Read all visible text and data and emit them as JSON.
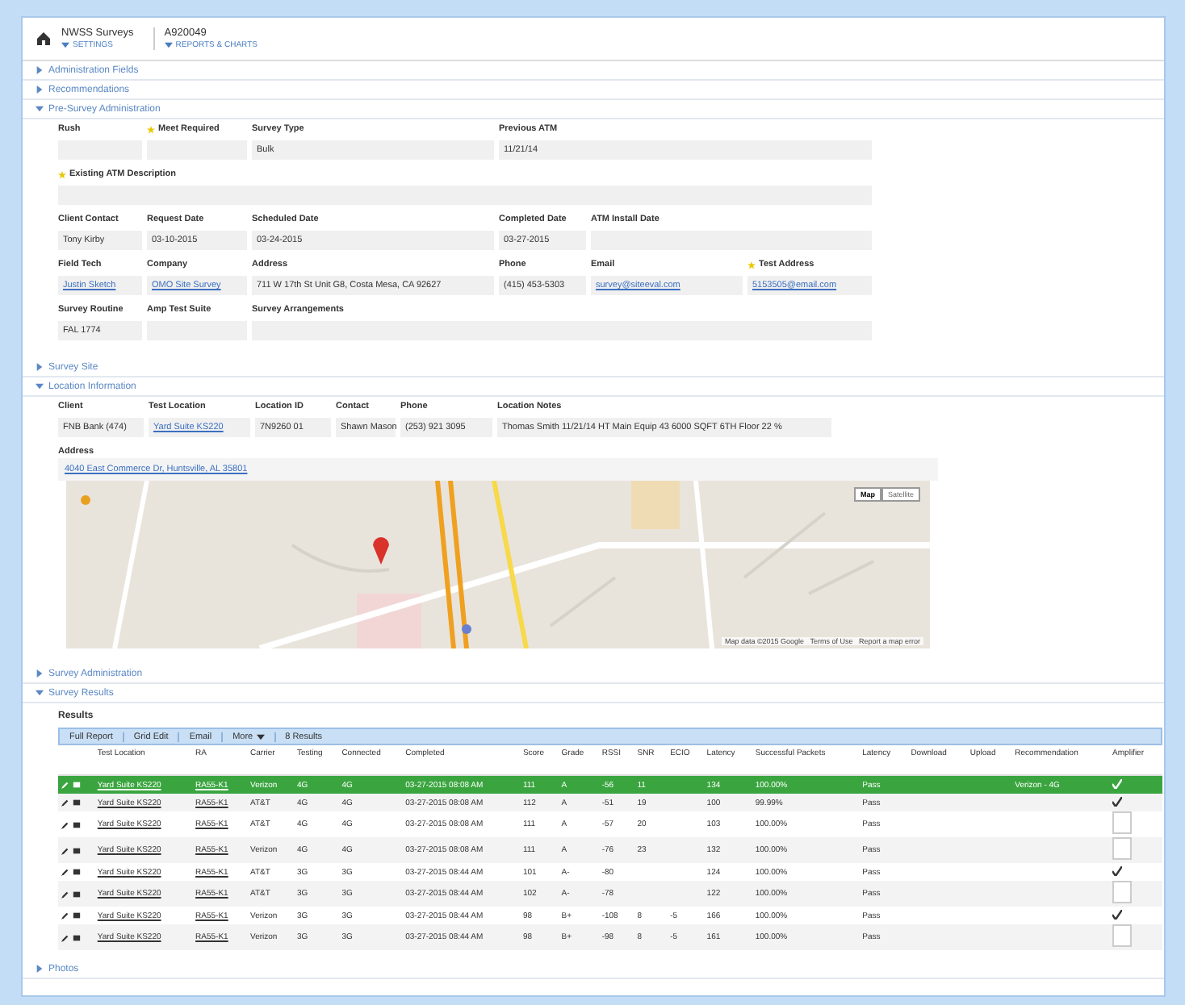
{
  "header": {
    "app": {
      "title": "NWSS Surveys",
      "menu": "SETTINGS"
    },
    "record": {
      "title": "A920049",
      "menu": "REPORTS & CHARTS"
    }
  },
  "sections": [
    {
      "title": "Administration Fields",
      "expanded": false
    },
    {
      "title": "Recommendations",
      "expanded": false
    },
    {
      "title": "Pre-Survey Administration",
      "expanded": true,
      "kind": "fields",
      "rows": [
        [
          {
            "label": "Rush",
            "required": false
          },
          {
            "label": "Meet Required",
            "required": true
          },
          {
            "label": "Survey Type",
            "value": "Bulk",
            "required": false
          },
          {
            "label": "Previous ATM",
            "value": "11/21/14",
            "required": false
          }
        ],
        [
          {
            "label": "Existing ATM Description",
            "required": true
          }
        ],
        [
          {
            "label": "Client Contact",
            "value": "Tony Kirby",
            "required": false
          },
          {
            "label": "Request Date",
            "value": "03-10-2015",
            "required": false
          },
          {
            "label": "Scheduled Date",
            "value": "03-24-2015",
            "required": false
          },
          {
            "label": "Completed Date",
            "value": "03-27-2015",
            "required": false
          },
          {
            "label": "ATM Install Date",
            "required": false
          }
        ],
        [
          {
            "label": "Field Tech",
            "value": "Justin Sketch",
            "link": true,
            "required": false
          },
          {
            "label": "Company",
            "value": "OMO Site Survey",
            "link": true,
            "required": false
          },
          {
            "label": "Address",
            "value": "711 W 17th St Unit G8, Costa Mesa, CA 92627",
            "link": false,
            "required": false
          },
          {
            "label": "Phone",
            "value": "(415) 453-5303",
            "link": false,
            "required": false
          },
          {
            "label": "Email",
            "value": "survey@siteeval.com",
            "link": true,
            "required": false
          },
          {
            "label": "Test Address",
            "value": "5153505@email.com",
            "link": true,
            "required": true
          }
        ],
        [
          {
            "label": "Survey Routine",
            "value": "FAL 1774",
            "required": false
          },
          {
            "label": "Amp Test Suite",
            "required": false
          },
          {
            "label": "Survey Arrangements",
            "required": false
          }
        ]
      ]
    },
    {
      "title": "Survey Site",
      "expanded": false
    },
    {
      "title": "Location Information",
      "expanded": true,
      "kind": "location",
      "fields": [
        {
          "label": "Client",
          "value": "FNB Bank (474)",
          "link": false
        },
        {
          "label": "Test Location",
          "value": "Yard Suite KS220",
          "link": true
        },
        {
          "label": "Location ID",
          "value": "7N9260 01",
          "link": false
        },
        {
          "label": "Contact",
          "value": "Shawn Mason",
          "link": false
        },
        {
          "label": "Phone",
          "value": "(253) 921 3095",
          "link": false
        },
        {
          "label": "Location Notes",
          "value": "Thomas Smith 11/21/14 HT Main Equip 43 6000 SQFT 6TH Floor 22 %",
          "link": false
        }
      ],
      "address": {
        "label": "Address",
        "value": "4040 East Commerce Dr, Huntsville, AL 35801"
      },
      "map": {
        "kind": "picture",
        "map_types": [
          {
            "label": "Map",
            "selected": true
          },
          {
            "label": "Satellite",
            "selected": false
          }
        ],
        "attribution": "Map data ©2015 Google   Terms of Use   Report a map error"
      }
    },
    {
      "title": "Survey Administration",
      "expanded": false
    },
    {
      "title": "Survey Results",
      "expanded": true,
      "kind": "results",
      "heading": "Results",
      "toolbar": [
        "Full Report",
        "Grid Edit",
        "Email",
        "More"
      ],
      "count": "8 Results",
      "columns": [
        "Test Location",
        "RA",
        "Carrier",
        "Testing",
        "Connected",
        "Completed",
        "Score",
        "Grade",
        "RSSI",
        "SNR",
        "ECIO",
        "Latency",
        "Successful Packets",
        "Latency",
        "Download",
        "Upload",
        "Recommendation",
        "Amplifier"
      ],
      "rows": [
        {
          "selected": true,
          "amplifier": true,
          "cells": {
            "test_location": "Yard Suite KS220",
            "ra": "RA55-K1",
            "carrier": "Verizon",
            "testing": "4G",
            "connected": "4G",
            "completed": "03-27-2015 08:08 AM",
            "score": "111",
            "grade": "A",
            "rssi": "-56",
            "snr": "11",
            "latency": "134",
            "packets": "100.00%",
            "latency_result": "Pass",
            "recommendation": "Verizon - 4G"
          }
        },
        {
          "selected": false,
          "amplifier": true,
          "cells": {
            "test_location": "Yard Suite KS220",
            "ra": "RA55-K1",
            "carrier": "AT&T",
            "testing": "4G",
            "connected": "4G",
            "completed": "03-27-2015 08:08 AM",
            "score": "112",
            "grade": "A",
            "rssi": "-51",
            "snr": "19",
            "latency": "100",
            "packets": "99.99%",
            "latency_result": "Pass"
          }
        },
        {
          "selected": false,
          "amplifier": false,
          "cells": {
            "test_location": "Yard Suite KS220",
            "ra": "RA55-K1",
            "carrier": "AT&T",
            "testing": "4G",
            "connected": "4G",
            "completed": "03-27-2015 08:08 AM",
            "score": "111",
            "grade": "A",
            "rssi": "-57",
            "snr": "20",
            "latency": "103",
            "packets": "100.00%",
            "latency_result": "Pass"
          }
        },
        {
          "selected": false,
          "amplifier": false,
          "cells": {
            "test_location": "Yard Suite KS220",
            "ra": "RA55-K1",
            "carrier": "Verizon",
            "testing": "4G",
            "connected": "4G",
            "completed": "03-27-2015 08:08 AM",
            "score": "111",
            "grade": "A",
            "rssi": "-76",
            "snr": "23",
            "latency": "132",
            "packets": "100.00%",
            "latency_result": "Pass"
          }
        },
        {
          "selected": false,
          "amplifier": true,
          "cells": {
            "test_location": "Yard Suite KS220",
            "ra": "RA55-K1",
            "carrier": "AT&T",
            "testing": "3G",
            "connected": "3G",
            "completed": "03-27-2015 08:44 AM",
            "score": "101",
            "grade": "A-",
            "rssi": "-80",
            "latency": "124",
            "packets": "100.00%",
            "latency_result": "Pass"
          }
        },
        {
          "selected": false,
          "amplifier": false,
          "cells": {
            "test_location": "Yard Suite KS220",
            "ra": "RA55-K1",
            "carrier": "AT&T",
            "testing": "3G",
            "connected": "3G",
            "completed": "03-27-2015 08:44 AM",
            "score": "102",
            "grade": "A-",
            "rssi": "-78",
            "latency": "122",
            "packets": "100.00%",
            "latency_result": "Pass"
          }
        },
        {
          "selected": false,
          "amplifier": true,
          "cells": {
            "test_location": "Yard Suite KS220",
            "ra": "RA55-K1",
            "carrier": "Verizon",
            "testing": "3G",
            "connected": "3G",
            "completed": "03-27-2015 08:44 AM",
            "score": "98",
            "grade": "B+",
            "rssi": "-108",
            "snr": "8",
            "ecio": "-5",
            "latency": "166",
            "packets": "100.00%",
            "latency_result": "Pass"
          }
        },
        {
          "selected": false,
          "amplifier": false,
          "cells": {
            "test_location": "Yard Suite KS220",
            "ra": "RA55-K1",
            "carrier": "Verizon",
            "testing": "3G",
            "connected": "3G",
            "completed": "03-27-2015 08:44 AM",
            "score": "98",
            "grade": "B+",
            "rssi": "-98",
            "snr": "8",
            "ecio": "-5",
            "latency": "161",
            "packets": "100.00%",
            "latency_result": "Pass"
          }
        }
      ]
    },
    {
      "title": "Photos",
      "expanded": false
    }
  ]
}
